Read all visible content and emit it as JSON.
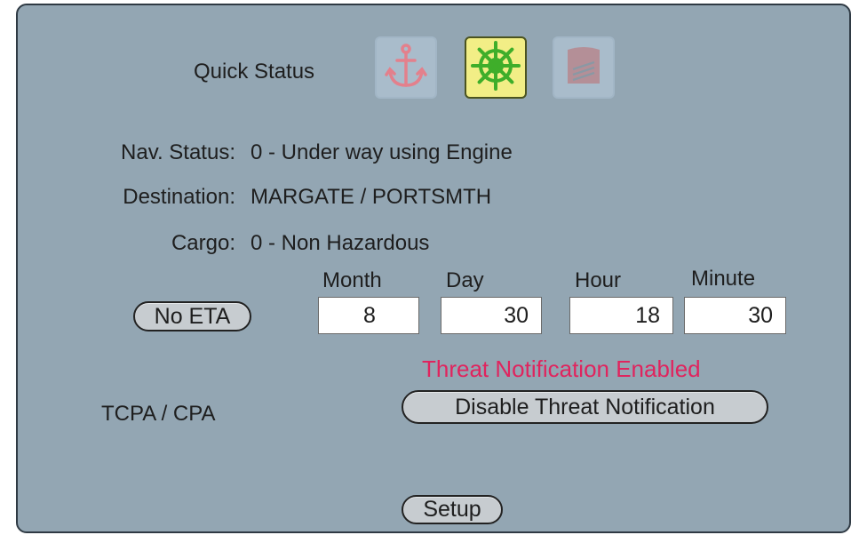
{
  "quick_status": {
    "label": "Quick Status",
    "buttons": [
      {
        "icon": "anchor-icon",
        "state": "inactive"
      },
      {
        "icon": "ship-wheel-icon",
        "state": "active"
      },
      {
        "icon": "cargo-icon",
        "state": "inactive"
      }
    ]
  },
  "fields": {
    "nav_status_label": "Nav. Status:",
    "nav_status_value": "0 - Under way using Engine",
    "destination_label": "Destination:",
    "destination_value": "MARGATE / PORTSMTH",
    "cargo_label": "Cargo:",
    "cargo_value": "0 - Non Hazardous"
  },
  "eta": {
    "no_eta_label": "No ETA",
    "month_label": "Month",
    "day_label": "Day",
    "hour_label": "Hour",
    "minute_label": "Minute",
    "month": "8",
    "day": "30",
    "hour": "18",
    "minute": "30"
  },
  "threat": {
    "section_label": "TCPA / CPA",
    "status_text": "Threat Notification Enabled",
    "status_color": "#e0245e",
    "toggle_label": "Disable Threat Notification"
  },
  "footer": {
    "setup_label": "Setup"
  },
  "colors": {
    "panel_bg": "#93a6b3",
    "active_button_bg": "#f2ee86",
    "wheel_green": "#3fae2a",
    "anchor_red": "#e3808c"
  }
}
